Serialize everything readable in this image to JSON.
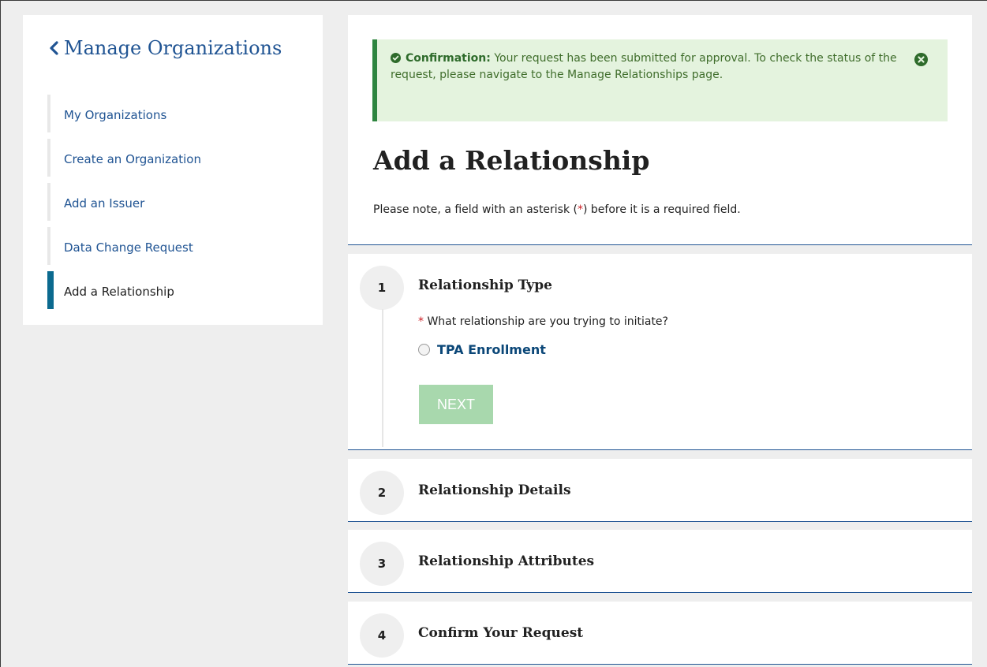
{
  "sidebar": {
    "title": "Manage Organizations",
    "items": [
      {
        "label": "My Organizations"
      },
      {
        "label": "Create an Organization"
      },
      {
        "label": "Add an Issuer"
      },
      {
        "label": "Data Change Request"
      },
      {
        "label": "Add a Relationship",
        "active": true
      }
    ]
  },
  "alert": {
    "lead": "Confirmation:",
    "message": "Your request has been submitted for approval. To check the status of the request, please navigate to the Manage Relationships page.",
    "color": "#2e8540"
  },
  "page": {
    "title": "Add a Relationship",
    "note_before": "Please note, a field with an asterisk (",
    "note_asterisk": "*",
    "note_after": ") before it is a required field."
  },
  "steps": [
    {
      "number": "1",
      "title": "Relationship Type",
      "required_mark": "*",
      "question": "What relationship are you trying to initiate?",
      "option": "TPA Enrollment",
      "next_label": "NEXT"
    },
    {
      "number": "2",
      "title": "Relationship Details"
    },
    {
      "number": "3",
      "title": "Relationship Attributes"
    },
    {
      "number": "4",
      "title": "Confirm Your Request"
    }
  ],
  "colors": {
    "link": "#205493",
    "active_bar": "#0b6a8f",
    "alert_bg": "#e4f3de",
    "button_disabled": "#a8d8ad",
    "required": "#cd2026"
  }
}
